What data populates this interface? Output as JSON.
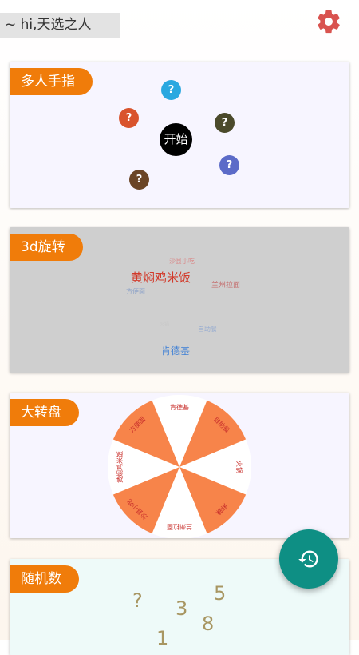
{
  "header": {
    "greeting": "~ hi,天选之人",
    "settings_icon": "gear-icon"
  },
  "cards": {
    "multi_finger": {
      "tag": "多人手指",
      "start_label": "开始",
      "fingers": [
        {
          "label": "?",
          "color": "#2aa8e0"
        },
        {
          "label": "?",
          "color": "#d9532c"
        },
        {
          "label": "?",
          "color": "#4b4a2b"
        },
        {
          "label": "?",
          "color": "#5c6bc8"
        },
        {
          "label": "?",
          "color": "#6b4526"
        }
      ]
    },
    "rotate3d": {
      "tag": "3d旋转",
      "words": [
        {
          "text": "沙县小吃",
          "color": "#d98a8a"
        },
        {
          "text": "黄焖鸡米饭",
          "color": "#d23a2a"
        },
        {
          "text": "兰州拉面",
          "color": "#c46a6a"
        },
        {
          "text": "方便面",
          "color": "#8aa0c8"
        },
        {
          "text": "火锅",
          "color": "#c8c8c8"
        },
        {
          "text": "自助餐",
          "color": "#9aaed0"
        },
        {
          "text": "肯德基",
          "color": "#3d7fd6"
        }
      ]
    },
    "wheel": {
      "tag": "大转盘",
      "segments": [
        "肯德基",
        "自助餐",
        "火锅",
        "麻辣",
        "兰州拉面",
        "沙县小吃",
        "黄焖鸡米饭",
        "方便面"
      ],
      "colors": {
        "orange": "#f7844a",
        "white": "#ffffff",
        "text": "#c9302c"
      }
    },
    "random": {
      "tag": "随机数",
      "digits": [
        "?",
        "3",
        "5",
        "8",
        "1"
      ]
    }
  },
  "fab": {
    "icon": "history-icon"
  }
}
